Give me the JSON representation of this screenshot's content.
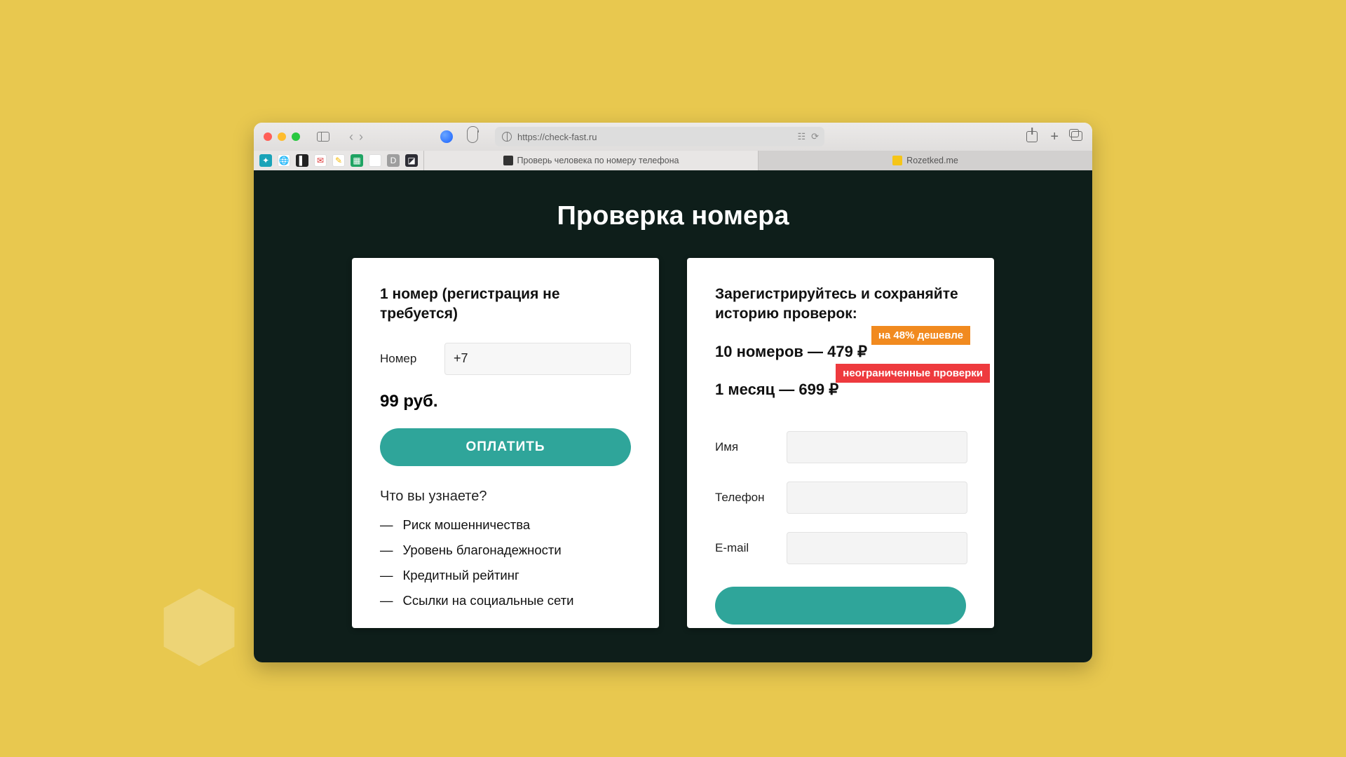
{
  "browser": {
    "url": "https://check-fast.ru",
    "tabs": [
      {
        "label": "Проверь человека по номеру телефона",
        "active": true
      },
      {
        "label": "Rozetked.me",
        "active": false
      }
    ]
  },
  "page": {
    "title": "Проверка номера"
  },
  "left_card": {
    "heading": "1 номер (регистрация не требуется)",
    "number_label": "Номер",
    "number_value": "+7",
    "price": "99 руб.",
    "pay_button": "ОПЛАТИТЬ",
    "subheading": "Что вы узнаете?",
    "features": [
      "Риск мошенничества",
      "Уровень благонадежности",
      "Кредитный рейтинг",
      "Ссылки на социальные сети"
    ]
  },
  "right_card": {
    "heading": "Зарегистрируйтесь и сохраняйте историю проверок:",
    "offer1": {
      "text": "10 номеров — 479 ₽",
      "badge": "на 48% дешевле"
    },
    "offer2": {
      "text": "1 месяц — 699 ₽",
      "badge": "неограниченные проверки"
    },
    "fields": {
      "name_label": "Имя",
      "phone_label": "Телефон",
      "email_label": "E-mail"
    }
  },
  "colors": {
    "accent": "#2fa59a",
    "badge_orange": "#f18a1f",
    "badge_red": "#ee3a3e"
  }
}
